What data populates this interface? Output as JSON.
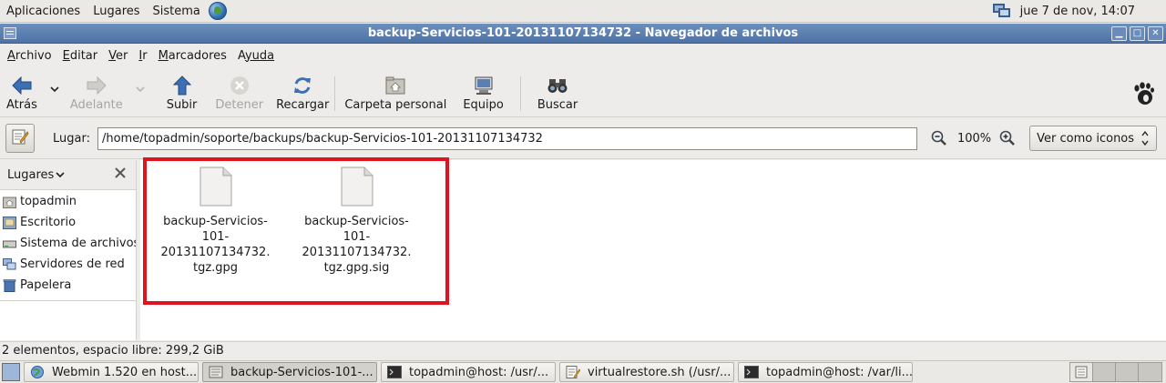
{
  "top_panel": {
    "menus": [
      "Aplicaciones",
      "Lugares",
      "Sistema"
    ],
    "clock": "jue  7 de nov, 14:07"
  },
  "window": {
    "title": "backup-Servicios-101-20131107134732 - Navegador de archivos",
    "wm_buttons": {
      "minimize": "▁",
      "maximize": "□",
      "close": "✕"
    }
  },
  "menubar": {
    "items": [
      {
        "label": "Archivo",
        "accel": "A",
        "rest": "rchivo"
      },
      {
        "label": "Editar",
        "accel": "E",
        "rest": "ditar"
      },
      {
        "label": "Ver",
        "accel": "V",
        "rest": "er"
      },
      {
        "label": "Ir",
        "accel": "I",
        "rest": "r"
      },
      {
        "label": "Marcadores",
        "accel": "M",
        "rest": "arcadores"
      },
      {
        "label": "Ayuda",
        "accel": "A",
        "rest": "yuda"
      }
    ]
  },
  "toolbar": {
    "back": "Atrás",
    "forward": "Adelante",
    "up": "Subir",
    "stop": "Detener",
    "reload": "Recargar",
    "home": "Carpeta personal",
    "computer": "Equipo",
    "search": "Buscar"
  },
  "location": {
    "label": "Lugar:",
    "path": "/home/topadmin/soporte/backups/backup-Servicios-101-20131107134732",
    "zoom": "100%",
    "view_mode": "Ver como iconos"
  },
  "sidebar": {
    "title": "Lugares",
    "items": [
      {
        "label": "topadmin",
        "icon": "home-folder-icon"
      },
      {
        "label": "Escritorio",
        "icon": "desktop-icon"
      },
      {
        "label": "Sistema de archivos",
        "icon": "drive-icon"
      },
      {
        "label": "Servidores de red",
        "icon": "network-icon"
      },
      {
        "label": "Papelera",
        "icon": "trash-icon"
      }
    ]
  },
  "files": [
    {
      "name": "backup-Servicios-101-20131107134732.tgz.gpg",
      "lines": [
        "backup-Servicios-",
        "101-",
        "20131107134732.",
        "tgz.gpg"
      ]
    },
    {
      "name": "backup-Servicios-101-20131107134732.tgz.gpg.sig",
      "lines": [
        "backup-Servicios-",
        "101-",
        "20131107134732.",
        "tgz.gpg.sig"
      ]
    }
  ],
  "status": "2 elementos, espacio libre: 299,2 GiB",
  "taskbar": {
    "tasks": [
      {
        "label": "Webmin 1.520 en host....",
        "icon": "browser-icon",
        "active": false
      },
      {
        "label": "backup-Servicios-101-...",
        "icon": "file-manager-icon",
        "active": true
      },
      {
        "label": "topadmin@host: /usr/...",
        "icon": "terminal-icon",
        "active": false
      },
      {
        "label": "virtualrestore.sh (/usr/...",
        "icon": "text-editor-icon",
        "active": false
      },
      {
        "label": "topadmin@host: /var/li...",
        "icon": "terminal-icon",
        "active": false
      }
    ]
  },
  "colors": {
    "highlight_box": "#e0141e",
    "titlebar": "#5a7db0"
  }
}
